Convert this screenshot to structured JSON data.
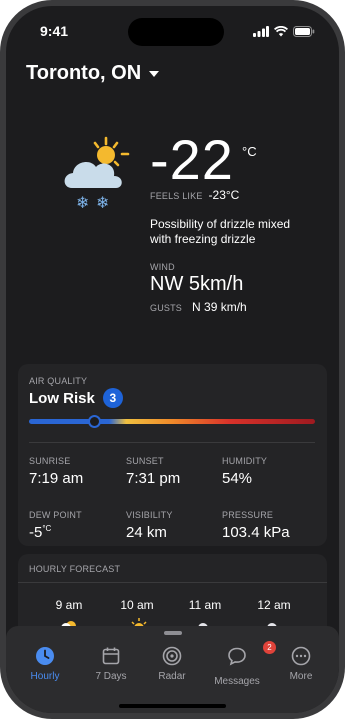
{
  "status": {
    "time": "9:41"
  },
  "location": {
    "name": "Toronto, ON"
  },
  "current": {
    "temperature": "-22",
    "unit": "°C",
    "feels_like_label": "FEELS LIKE",
    "feels_like_value": "-23°C",
    "description": "Possibility of drizzle mixed with freezing drizzle",
    "icon": "sun-cloud-snow-icon",
    "wind_label": "WIND",
    "wind_value": "NW 5km/h",
    "gusts_label": "GUSTS",
    "gusts_value": "N 39 km/h"
  },
  "air_quality": {
    "label": "AIR QUALITY",
    "risk": "Low Risk",
    "index": "3",
    "index_fraction": 0.23
  },
  "metrics": [
    {
      "label": "SUNRISE",
      "value": "7:19 am"
    },
    {
      "label": "SUNSET",
      "value": "7:31 pm"
    },
    {
      "label": "HUMIDITY",
      "value": "54%"
    },
    {
      "label": "DEW POINT",
      "value": "-5",
      "unit": "°C"
    },
    {
      "label": "VISIBILITY",
      "value": "24 km"
    },
    {
      "label": "PRESSURE",
      "value": "103.4 kPa"
    }
  ],
  "hourly": {
    "title": "HOURLY FORECAST",
    "hours": [
      "9 am",
      "10 am",
      "11 am",
      "12 am"
    ]
  },
  "tabs": [
    {
      "label": "Hourly",
      "icon": "clock-icon",
      "active": true
    },
    {
      "label": "7 Days",
      "icon": "calendar-icon"
    },
    {
      "label": "Radar",
      "icon": "radar-icon"
    },
    {
      "label": "Messages",
      "icon": "message-icon",
      "badge": "2"
    },
    {
      "label": "More",
      "icon": "more-icon"
    }
  ],
  "colors": {
    "accent": "#4a8cf0",
    "badge": "#e0433a",
    "aq_blue": "#1e63d8",
    "background": "#1c1c1e"
  }
}
